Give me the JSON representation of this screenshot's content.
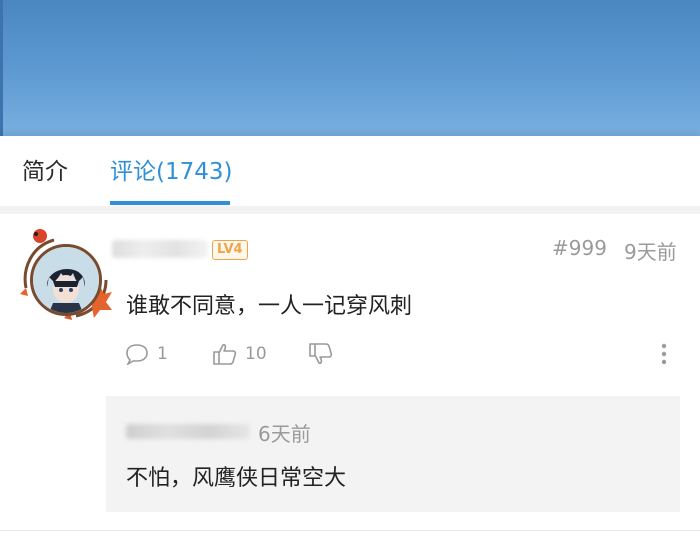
{
  "tabs": {
    "intro_label": "简介",
    "comments_label": "评论(1743)"
  },
  "comment": {
    "level_badge": "LV4",
    "floor": "#999",
    "time": "9天前",
    "text": "谁敢不同意，一人一记穿风刺",
    "reply_count": "1",
    "like_count": "10"
  },
  "reply": {
    "time": "6天前",
    "text": "不怕，风鹰侠日常空大"
  },
  "colors": {
    "accent": "#2f90d8",
    "banner": "#5f9bd2",
    "badge": "#f0a44a"
  }
}
